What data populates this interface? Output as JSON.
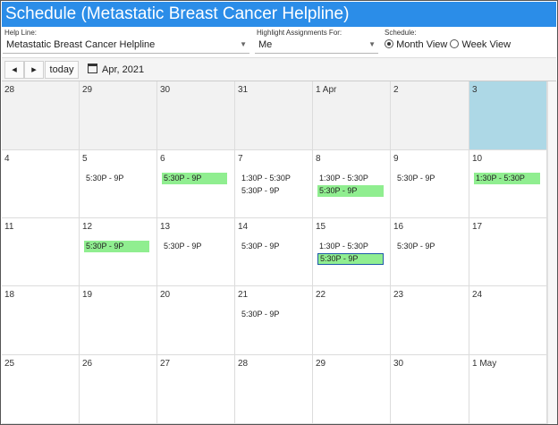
{
  "title": "Schedule (Metastatic Breast Cancer Helpline)",
  "filters": {
    "help_line": {
      "label": "Help Line:",
      "value": "Metastatic Breast Cancer Helpline"
    },
    "highlight": {
      "label": "Highlight Assignments For:",
      "value": "Me"
    },
    "schedule": {
      "label": "Schedule:",
      "options": [
        "Month View",
        "Week View"
      ],
      "selected": "Month View"
    }
  },
  "toolbar": {
    "prev_label": "◂",
    "next_label": "▸",
    "today_label": "today",
    "period_label": "Apr, 2021"
  },
  "calendar": {
    "weeks": [
      [
        {
          "label": "28",
          "style": "gray",
          "events": []
        },
        {
          "label": "29",
          "style": "gray",
          "events": []
        },
        {
          "label": "30",
          "style": "gray",
          "events": []
        },
        {
          "label": "31",
          "style": "gray",
          "events": []
        },
        {
          "label": "1 Apr",
          "style": "gray",
          "events": []
        },
        {
          "label": "2",
          "style": "gray",
          "events": []
        },
        {
          "label": "3",
          "style": "today",
          "events": []
        }
      ],
      [
        {
          "label": "4",
          "events": []
        },
        {
          "label": "5",
          "events": [
            {
              "text": "5:30P - 9P"
            }
          ]
        },
        {
          "label": "6",
          "events": [
            {
              "text": "5:30P - 9P",
              "highlight": true
            }
          ]
        },
        {
          "label": "7",
          "events": [
            {
              "text": "1:30P - 5:30P"
            },
            {
              "text": "5:30P - 9P"
            }
          ]
        },
        {
          "label": "8",
          "events": [
            {
              "text": "1:30P - 5:30P"
            },
            {
              "text": "5:30P - 9P",
              "highlight": true
            }
          ]
        },
        {
          "label": "9",
          "events": [
            {
              "text": "5:30P - 9P"
            }
          ]
        },
        {
          "label": "10",
          "events": [
            {
              "text": "1:30P - 5:30P",
              "highlight": true
            }
          ]
        }
      ],
      [
        {
          "label": "11",
          "events": []
        },
        {
          "label": "12",
          "events": [
            {
              "text": "5:30P - 9P",
              "highlight": true
            }
          ]
        },
        {
          "label": "13",
          "events": [
            {
              "text": "5:30P - 9P"
            }
          ]
        },
        {
          "label": "14",
          "events": [
            {
              "text": "5:30P - 9P"
            }
          ]
        },
        {
          "label": "15",
          "events": [
            {
              "text": "1:30P - 5:30P"
            },
            {
              "text": "5:30P - 9P",
              "highlight": true,
              "selected": true
            }
          ]
        },
        {
          "label": "16",
          "events": [
            {
              "text": "5:30P - 9P"
            }
          ]
        },
        {
          "label": "17",
          "events": []
        }
      ],
      [
        {
          "label": "18",
          "events": []
        },
        {
          "label": "19",
          "events": []
        },
        {
          "label": "20",
          "events": []
        },
        {
          "label": "21",
          "events": [
            {
              "text": "5:30P - 9P"
            }
          ]
        },
        {
          "label": "22",
          "events": []
        },
        {
          "label": "23",
          "events": []
        },
        {
          "label": "24",
          "events": []
        }
      ],
      [
        {
          "label": "25",
          "events": []
        },
        {
          "label": "26",
          "events": []
        },
        {
          "label": "27",
          "events": []
        },
        {
          "label": "28",
          "events": []
        },
        {
          "label": "29",
          "events": []
        },
        {
          "label": "30",
          "events": []
        },
        {
          "label": "1 May",
          "events": []
        }
      ]
    ]
  },
  "colors": {
    "title_bar": "#2b8de8",
    "highlight": "#90ee90",
    "today": "#add8e6",
    "other_month": "#f2f2f2"
  }
}
